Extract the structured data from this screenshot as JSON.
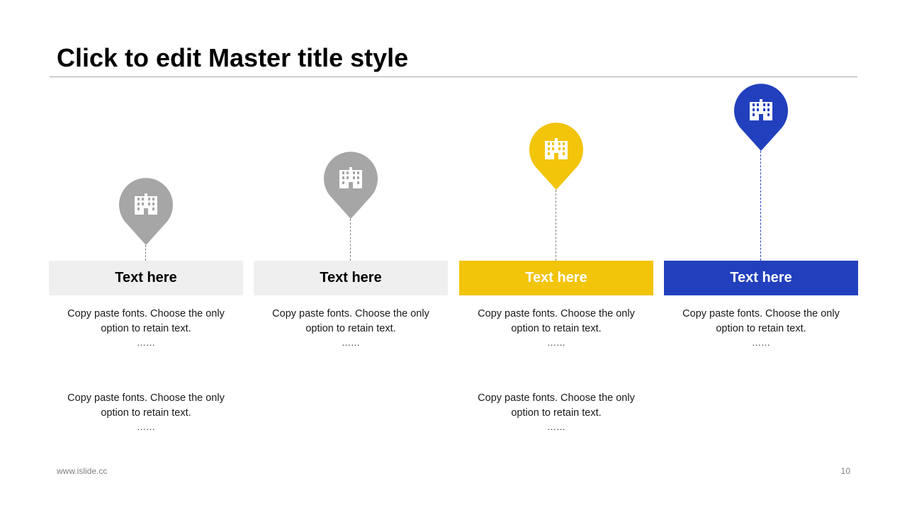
{
  "slide": {
    "title": "Click to edit Master title style",
    "footer_url": "www.islide.cc",
    "page_number": "10"
  },
  "colors": {
    "gray_pin": "#a6a6a6",
    "gray_bar": "#efefef",
    "yellow": "#f2c40a",
    "blue": "#2240bd",
    "connector_gray": "#7f7f7f",
    "connector_blue": "#2240bd"
  },
  "columns": [
    {
      "icon": "building-icon",
      "label": "Text here",
      "text_line_1": "Copy paste fonts. Choose the only",
      "text_line_2": "option to retain text.",
      "dots": "……",
      "text2_line_1": "Copy paste fonts. Choose the only",
      "text2_line_2": "option to retain text.",
      "dots2": "……"
    },
    {
      "icon": "building-icon",
      "label": "Text here",
      "text_line_1": "Copy paste fonts. Choose the only",
      "text_line_2": "option to retain text.",
      "dots": "……"
    },
    {
      "icon": "building-icon",
      "label": "Text here",
      "text_line_1": "Copy paste fonts. Choose the only",
      "text_line_2": "option to retain text.",
      "dots": "……",
      "text2_line_1": "Copy paste fonts. Choose the only",
      "text2_line_2": "option to retain text.",
      "dots2": "……"
    },
    {
      "icon": "building-icon",
      "label": "Text here",
      "text_line_1": "Copy paste fonts. Choose the only",
      "text_line_2": "option to retain text.",
      "dots": "……"
    }
  ]
}
